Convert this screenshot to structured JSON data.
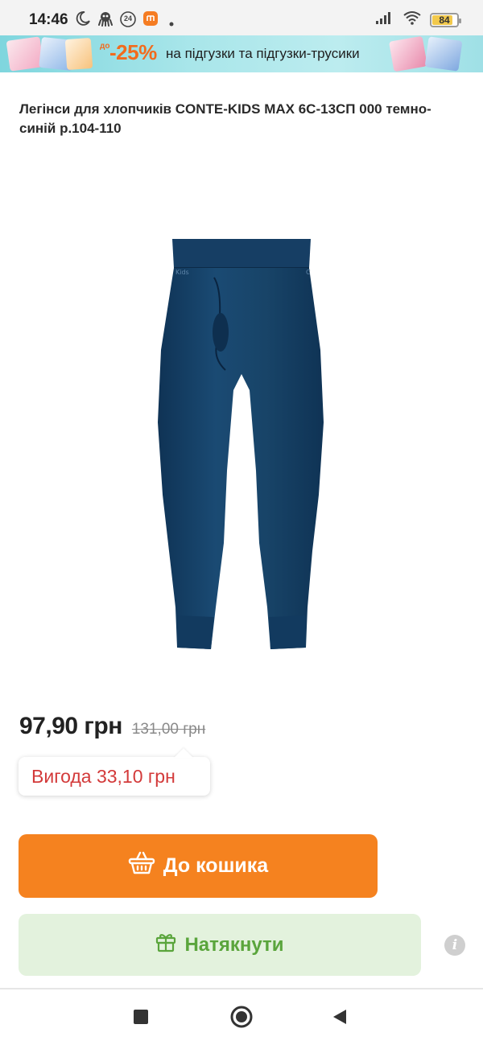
{
  "status_bar": {
    "time": "14:46",
    "badge_24": "24",
    "battery_level": 84,
    "battery_text": "84",
    "icons": [
      "moon-icon",
      "octopus-icon",
      "badge-24-icon",
      "app-notification-icon",
      "dot-icon",
      "signal-icon",
      "wifi-icon",
      "battery-icon"
    ]
  },
  "promo": {
    "prefix": "до",
    "discount": "-25%",
    "text": "на підгузки та підгузки-трусики"
  },
  "product": {
    "title": "Легінси для хлопчиків CONTE-KIDS MAX 6С-13СП 000 темно-синій р.104-110",
    "price_current": "97,90 грн",
    "price_old": "131,00 грн",
    "savings": "Вигода 33,10 грн"
  },
  "actions": {
    "cart_label": "До кошика",
    "hint_label": "Натякнути",
    "info_icon_glyph": "i"
  },
  "colors": {
    "accent_orange": "#f5821f",
    "hint_bg": "#e3f2dd",
    "hint_text": "#5aa53c",
    "savings_red": "#d33a3a",
    "product_navy": "#163f63"
  },
  "nav": {
    "buttons": [
      "recents-square-icon",
      "home-circle-icon",
      "back-triangle-icon"
    ]
  }
}
